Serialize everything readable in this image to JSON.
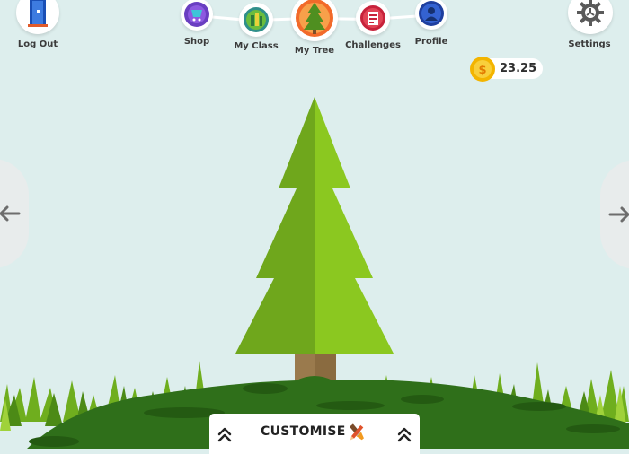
{
  "nav": {
    "logout": "Log Out",
    "shop": "Shop",
    "my_class": "My Class",
    "my_tree": "My Tree",
    "challenges": "Challenges",
    "profile": "Profile",
    "settings": "Settings"
  },
  "wallet": {
    "coins": "23.25",
    "icon": "coin-icon"
  },
  "customise": {
    "label": "CUSTOMISE"
  },
  "colors": {
    "background": "#ddeeed",
    "tree_light": "#8bc820",
    "tree_dark": "#6fa71c",
    "trunk": "#9a7a4d",
    "hill": "#2f6f1a",
    "active_tab": "#f26a2a"
  }
}
